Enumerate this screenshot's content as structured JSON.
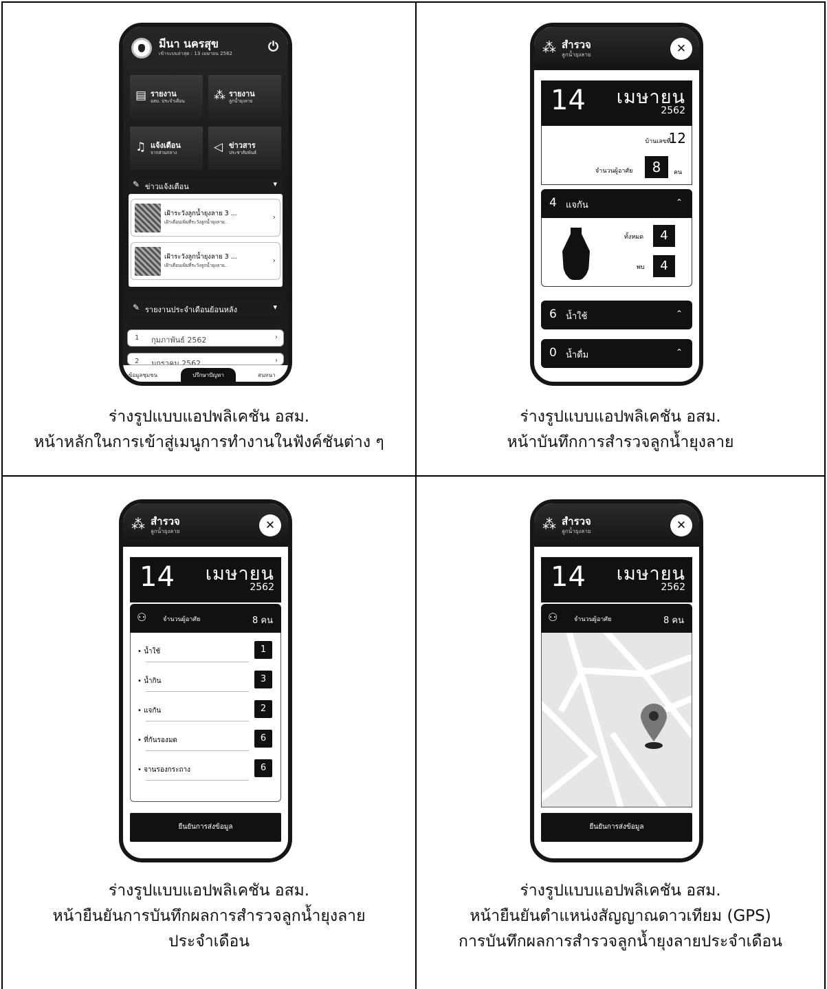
{
  "captions": [
    {
      "line1": "ร่างรูปแบบแอปพลิเคชัน อสม.",
      "line2": "หน้าหลักในการเข้าสู่เมนูการทำงานในฟังค์ชันต่าง ๆ",
      "line3": ""
    },
    {
      "line1": "ร่างรูปแบบแอปพลิเคชัน อสม.",
      "line2": "หน้าบันทึกการสำรวจลูกน้ำยุงลาย",
      "line3": ""
    },
    {
      "line1": "ร่างรูปแบบแอปพลิเคชัน อสม.",
      "line2": "หน้ายืนยันการบันทึกผลการสำรวจลูกน้ำยุงลาย",
      "line3": "ประจำเดือน"
    },
    {
      "line1": "ร่างรูปแบบแอปพลิเคชัน อสม.",
      "line2": "หน้ายืนยันตำแหน่งสัญญาณดาวเทียม (GPS)",
      "line3": "การบันทึกผลการสำรวจลูกน้ำยุงลายประจำเดือน"
    }
  ],
  "home": {
    "user_name": "มีนา นครสุข",
    "last_login": "เข้าระบบล่าสุด : 13 เมษายน 2562",
    "tiles": [
      {
        "title": "รายงาน",
        "subtitle": "อสม. ประจำเดือน",
        "icon": "report-icon"
      },
      {
        "title": "รายงาน",
        "subtitle": "ลูกน้ำยุงลาย",
        "icon": "mosquito-icon"
      },
      {
        "title": "แจ้งเตือน",
        "subtitle": "จากส่วนกลาง",
        "icon": "bell-icon"
      },
      {
        "title": "ข่าวสาร",
        "subtitle": "ประชาสัมพันธ์",
        "icon": "megaphone-icon"
      }
    ],
    "news_section": "ข่าวแจ้งเตือน",
    "news": [
      {
        "title": "เฝ้าระวังลูกน้ำยุงลาย 3 ...",
        "subtitle": "เฝ้าเตือนเพิ่มที่ระวังลูกน้ำยุงลาย.."
      },
      {
        "title": "เฝ้าระวังลูกน้ำยุงลาย 3 ...",
        "subtitle": "เฝ้าเตือนเพิ่มที่ระวังลูกน้ำยุงลาย.."
      }
    ],
    "report_section": "รายงานประจำเดือนย้อนหลัง",
    "months": [
      {
        "num": "1",
        "name": "กุมภาพันธ์ 2562"
      },
      {
        "num": "2",
        "name": "มกราคม 2562"
      }
    ],
    "nav": {
      "left": "ข้อมูลชุมชน",
      "center": "ปรึกษาปัญหา",
      "right": "สนทนา"
    }
  },
  "survey": {
    "title": "สำรวจ",
    "subtitle": "ลูกน้ำยุงลาย",
    "close": "✕",
    "day": "14",
    "month": "เมษายน",
    "year": "2562",
    "house_label": "บ้านเลขที่",
    "house_no": "12",
    "residents_label": "จำนวนผู้อาศัย",
    "residents": "8",
    "residents_unit": "คน",
    "residents_display": "8 คน",
    "containers": [
      {
        "count": "4",
        "name": "แจกัน"
      },
      {
        "count": "6",
        "name": "น้ำใช้"
      },
      {
        "count": "0",
        "name": "น้ำดื่ม"
      }
    ],
    "jar_total_label": "ทั้งหมด",
    "jar_total": "4",
    "jar_found_label": "พบ",
    "jar_found": "4",
    "summary": [
      {
        "name": "• น้ำใช้",
        "value": "1"
      },
      {
        "name": "• น้ำกิน",
        "value": "3"
      },
      {
        "name": "• แจกัน",
        "value": "2"
      },
      {
        "name": "• ที่กันรองมด",
        "value": "6"
      },
      {
        "name": "• จานรองกระถาง",
        "value": "6"
      }
    ],
    "confirm": "ยืนยันการส่งข้อมูล"
  }
}
